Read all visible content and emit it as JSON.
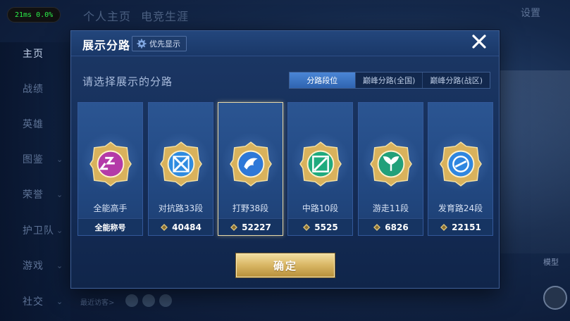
{
  "fps": {
    "latency": "21ms",
    "loss": "0.0%"
  },
  "background": {
    "top_tabs": [
      "个人主页",
      "电竞生涯"
    ],
    "settings_label": "设置",
    "nav_items": [
      {
        "label": "主页",
        "has_chevron": false
      },
      {
        "label": "战绩",
        "has_chevron": false
      },
      {
        "label": "英雄",
        "has_chevron": false
      },
      {
        "label": "图鉴",
        "has_chevron": true
      },
      {
        "label": "荣誉",
        "has_chevron": true
      },
      {
        "label": "护卫队",
        "has_chevron": true
      },
      {
        "label": "游戏",
        "has_chevron": true
      },
      {
        "label": "社交",
        "has_chevron": true
      }
    ],
    "recent_visitors_label": "最近访客>",
    "model_label": "模型"
  },
  "modal": {
    "title": "展示分路",
    "priority_label": "优先显示",
    "prompt": "请选择展示的分路",
    "tabs": [
      {
        "label": "分路段位",
        "active": true
      },
      {
        "label": "巅峰分路(全国)",
        "active": false
      },
      {
        "label": "巅峰分路(战区)",
        "active": false
      }
    ],
    "cards": [
      {
        "name": "全能高手",
        "value": "全能称号",
        "show_icon": false,
        "selected": false,
        "emblem": "#b43aa8",
        "emblem_icon": "allround-emblem-icon"
      },
      {
        "name": "对抗路33段",
        "value": "40484",
        "show_icon": true,
        "selected": false,
        "emblem": "#2f8be0",
        "emblem_icon": "clash-lane-emblem-icon"
      },
      {
        "name": "打野38段",
        "value": "52227",
        "show_icon": true,
        "selected": true,
        "emblem": "#2e78d8",
        "emblem_icon": "jungle-emblem-icon"
      },
      {
        "name": "中路10段",
        "value": "5525",
        "show_icon": true,
        "selected": false,
        "emblem": "#1faa7e",
        "emblem_icon": "mid-lane-emblem-icon"
      },
      {
        "name": "游走11段",
        "value": "6826",
        "show_icon": true,
        "selected": false,
        "emblem": "#22a07a",
        "emblem_icon": "roam-emblem-icon"
      },
      {
        "name": "发育路24段",
        "value": "22151",
        "show_icon": true,
        "selected": false,
        "emblem": "#2f86e0",
        "emblem_icon": "farm-lane-emblem-icon"
      }
    ],
    "confirm_label": "确定"
  }
}
